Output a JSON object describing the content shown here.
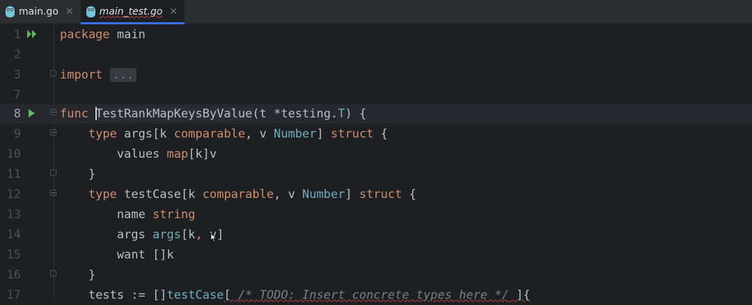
{
  "tabs": [
    {
      "label": "main.go",
      "active": false,
      "close": "✕"
    },
    {
      "label": "main_test.go",
      "active": true,
      "close": "✕"
    }
  ],
  "lines": [
    {
      "num": "1"
    },
    {
      "num": "2"
    },
    {
      "num": "3"
    },
    {
      "num": "7"
    },
    {
      "num": "8"
    },
    {
      "num": "9"
    },
    {
      "num": "10"
    },
    {
      "num": "11"
    },
    {
      "num": "12"
    },
    {
      "num": "13"
    },
    {
      "num": "14"
    },
    {
      "num": "15"
    },
    {
      "num": "16"
    },
    {
      "num": "17"
    }
  ],
  "code": {
    "l1": {
      "kw": "package",
      "name": " main"
    },
    "l3": {
      "kw": "import",
      "sp": " ",
      "folded": "..."
    },
    "l8": {
      "kw": "func",
      "sp": " ",
      "fn": "TestRankMapKeysByValue",
      "p1": "(t *",
      "pkg": "testing.",
      "ty": "T",
      "p2": ") {"
    },
    "l9": {
      "ind": "    ",
      "kw": "type",
      "a": " args[k ",
      "kw2": "comparable",
      "b": ", v ",
      "ty": "Number",
      "c": "] ",
      "kw3": "struct",
      "d": " {"
    },
    "l10": {
      "ind": "        ",
      "a": "values ",
      "kw": "map",
      "b": "[k]v"
    },
    "l11": {
      "ind": "    ",
      "a": "}"
    },
    "l12": {
      "ind": "    ",
      "kw": "type",
      "a": " testCase[k ",
      "kw2": "comparable",
      "b": ", v ",
      "ty": "Number",
      "c": "] ",
      "kw3": "struct",
      "d": " {"
    },
    "l13": {
      "ind": "        ",
      "a": "name ",
      "kw": "string"
    },
    "l14": {
      "ind": "        ",
      "a": "args ",
      "ty": "args",
      "b": "[k",
      "kw": ",",
      "c": " v]"
    },
    "l15": {
      "ind": "        ",
      "a": "want []k"
    },
    "l16": {
      "ind": "    ",
      "a": "}"
    },
    "l17": {
      "ind": "    ",
      "a": "tests := []",
      "ty": "testCase",
      "b": "[ ",
      "cm": "/* TODO: Insert concrete types here */",
      "c": " ]{"
    }
  },
  "colors": {
    "keyword": "#cf8e6d",
    "type": "#6fafbd",
    "text": "#bcbec4",
    "comment": "#7a7e85",
    "run": "#5fb865",
    "tab_accent": "#3574f0"
  },
  "icons": {
    "run_multi": "double-play-icon",
    "run_single": "play-icon",
    "file": "gopher-icon"
  }
}
